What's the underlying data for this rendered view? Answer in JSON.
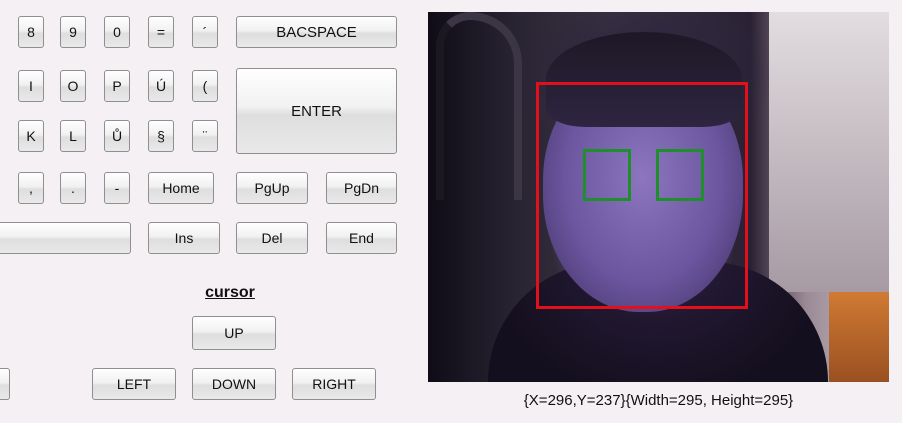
{
  "keyboard": {
    "row1": [
      "8",
      "9",
      "0",
      "=",
      "´",
      "BACSPACE"
    ],
    "row2": [
      "I",
      "O",
      "P",
      "Ú",
      "("
    ],
    "row3": [
      "K",
      "L",
      "Ů",
      "§",
      "¨"
    ],
    "enter": "ENTER",
    "row4": [
      ",",
      ".",
      "-",
      "Home",
      "PgUp",
      "PgDn"
    ],
    "row5": [
      "",
      "Ins",
      "Del",
      "End"
    ],
    "cursor": {
      "title": "cursor",
      "up": "UP",
      "left": "LEFT",
      "down": "DOWN",
      "right": "RIGHT",
      "partial_left_key": ""
    }
  },
  "camera": {
    "face_readout": "{X=296,Y=237}{Width=295, Height=295}",
    "face_box_color": "#e3101c",
    "eye_box_color": "#1e8f2a"
  }
}
